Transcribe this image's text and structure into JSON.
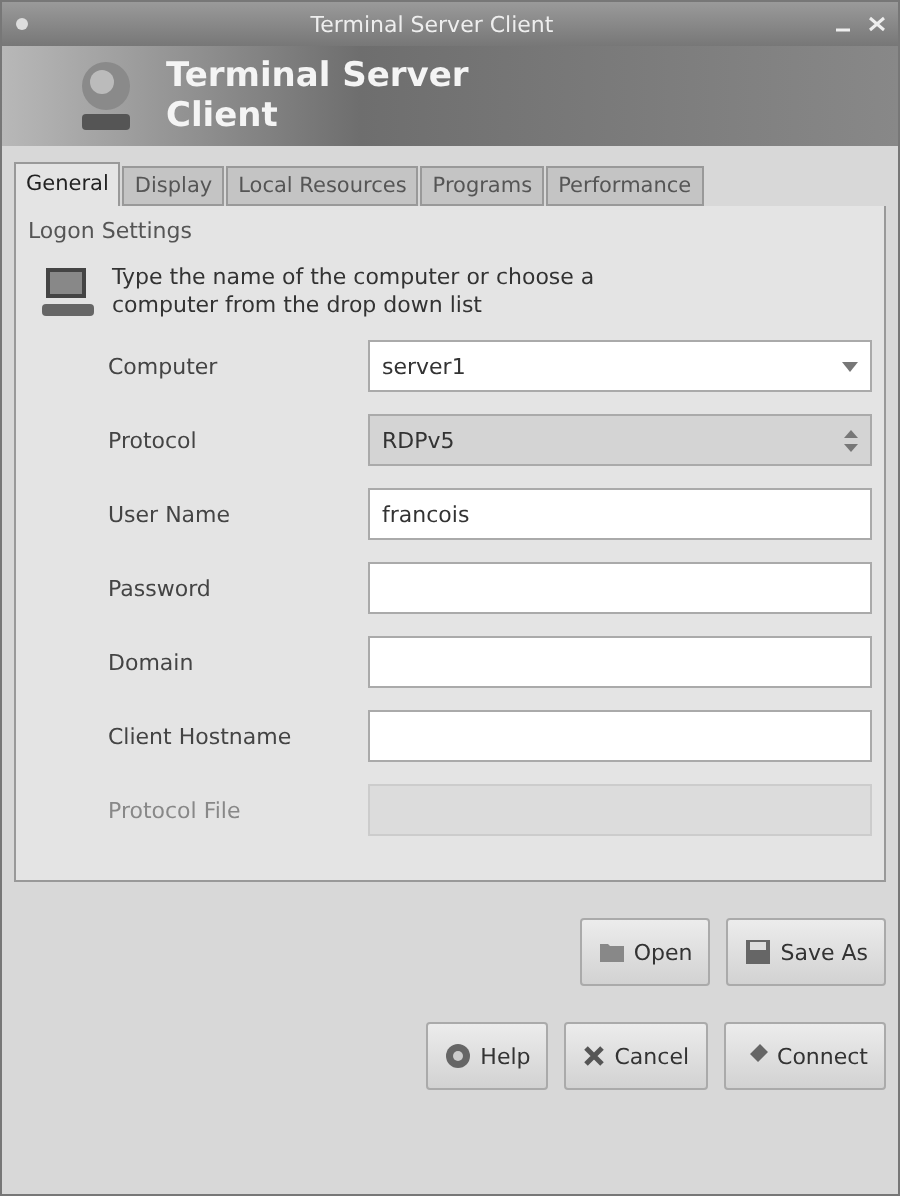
{
  "window": {
    "title": "Terminal Server Client"
  },
  "banner": {
    "line_1": "Terminal Server",
    "line_2": "Client"
  },
  "tabs": [
    {
      "label": "General",
      "selected": true
    },
    {
      "label": "Display",
      "selected": false
    },
    {
      "label": "Local Resources",
      "selected": false
    },
    {
      "label": "Programs",
      "selected": false
    },
    {
      "label": "Performance",
      "selected": false
    }
  ],
  "logon_settings": {
    "title": "Logon Settings",
    "hint": "Type the name of the computer or choose a computer from the drop down list",
    "fields": [
      {
        "label": "Computer",
        "kind": "combo",
        "value": "server1",
        "disabled": false
      },
      {
        "label": "Protocol",
        "kind": "select",
        "value": "RDPv5",
        "disabled": false
      },
      {
        "label": "User Name",
        "kind": "text",
        "value": "francois",
        "disabled": false
      },
      {
        "label": "Password",
        "kind": "text",
        "disabled": false
      },
      {
        "label": "Domain",
        "kind": "text",
        "disabled": false
      },
      {
        "label": "Client Hostname",
        "kind": "text",
        "disabled": false
      },
      {
        "label": "Protocol File",
        "kind": "file",
        "disabled": true
      }
    ]
  },
  "file_buttons": [
    {
      "label": "Open",
      "kind": "open"
    },
    {
      "label": "Save As",
      "kind": "save"
    }
  ],
  "dialog_buttons": [
    {
      "label": "Help",
      "kind": "help"
    },
    {
      "label": "Cancel",
      "kind": "cancel"
    },
    {
      "label": "Connect",
      "kind": "connect"
    }
  ]
}
